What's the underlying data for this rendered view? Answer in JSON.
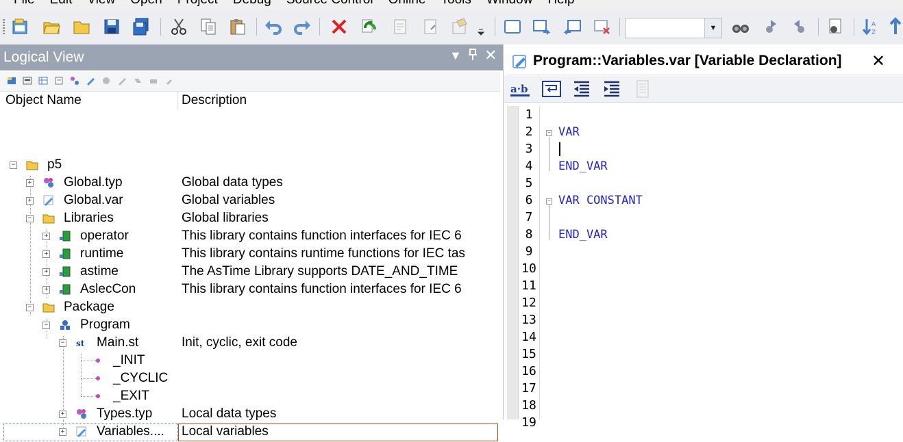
{
  "menubar": {
    "items": [
      "File",
      "Edit",
      "View",
      "Open",
      "Project",
      "Debug",
      "Source Control",
      "Online",
      "Tools",
      "Window",
      "Help"
    ]
  },
  "toolbar": {
    "icons": [
      "new-project-icon",
      "open-folder-icon",
      "open-icon",
      "save-icon",
      "save-all-icon",
      "cut-icon",
      "copy-icon",
      "paste-icon",
      "undo-icon",
      "redo-icon",
      "delete-icon",
      "refresh-icon",
      "properties-icon",
      "properties-alt-icon",
      "settings-icon",
      "window-icon",
      "window-forward-icon",
      "window-back-icon",
      "window-close-icon",
      "binoculars-icon",
      "find-next-icon",
      "find-prev-icon",
      "find-files-icon",
      "sort-icon",
      "up-arrow-icon"
    ],
    "search_value": ""
  },
  "logical_view": {
    "title": "Logical View",
    "columns": {
      "name": "Object Name",
      "description": "Description"
    },
    "rows": [
      {
        "name": "p5",
        "desc": "",
        "icon": "folder-icon"
      },
      {
        "name": "Global.typ",
        "desc": "Global data types",
        "icon": "datatype-icon"
      },
      {
        "name": "Global.var",
        "desc": "Global variables",
        "icon": "variable-icon"
      },
      {
        "name": "Libraries",
        "desc": "Global libraries",
        "icon": "folder-icon"
      },
      {
        "name": "operator",
        "desc": "This library contains function interfaces for IEC 6",
        "icon": "library-icon"
      },
      {
        "name": "runtime",
        "desc": "This library contains runtime functions for IEC tas",
        "icon": "library-icon"
      },
      {
        "name": "astime",
        "desc": "The AsTime Library supports DATE_AND_TIME",
        "icon": "library-icon"
      },
      {
        "name": "AslecCon",
        "desc": "This library contains function interfaces for IEC 6",
        "icon": "library-icon"
      },
      {
        "name": "Package",
        "desc": "",
        "icon": "folder-icon"
      },
      {
        "name": "Program",
        "desc": "",
        "icon": "program-icon"
      },
      {
        "name": "Main.st",
        "desc": "Init, cyclic, exit code",
        "icon": "st-file-icon"
      },
      {
        "name": "_INIT",
        "desc": "",
        "icon": "action-icon"
      },
      {
        "name": "_CYCLIC",
        "desc": "",
        "icon": "action-icon"
      },
      {
        "name": "_EXIT",
        "desc": "",
        "icon": "action-icon"
      },
      {
        "name": "Types.typ",
        "desc": "Local data types",
        "icon": "datatype-icon"
      },
      {
        "name": "Variables....",
        "desc": "Local variables",
        "icon": "variable-icon"
      }
    ]
  },
  "editor": {
    "tab_title": "Program::Variables.var [Variable Declaration]",
    "close_glyph": "✕",
    "line_numbers": [
      "1",
      "2",
      "3",
      "4",
      "5",
      "6",
      "7",
      "8",
      "9",
      "10",
      "11",
      "12",
      "13",
      "14",
      "15",
      "16",
      "17",
      "18",
      "19"
    ],
    "lines": [
      "",
      "VAR",
      "",
      "END_VAR",
      "",
      "VAR CONSTANT",
      "",
      "END_VAR",
      "",
      "",
      "",
      "",
      "",
      "",
      "",
      "",
      "",
      "",
      ""
    ],
    "colors": {
      "keyword": "#2323c8",
      "header": "#9aa4b2",
      "selection_border": "#b9470e"
    }
  }
}
